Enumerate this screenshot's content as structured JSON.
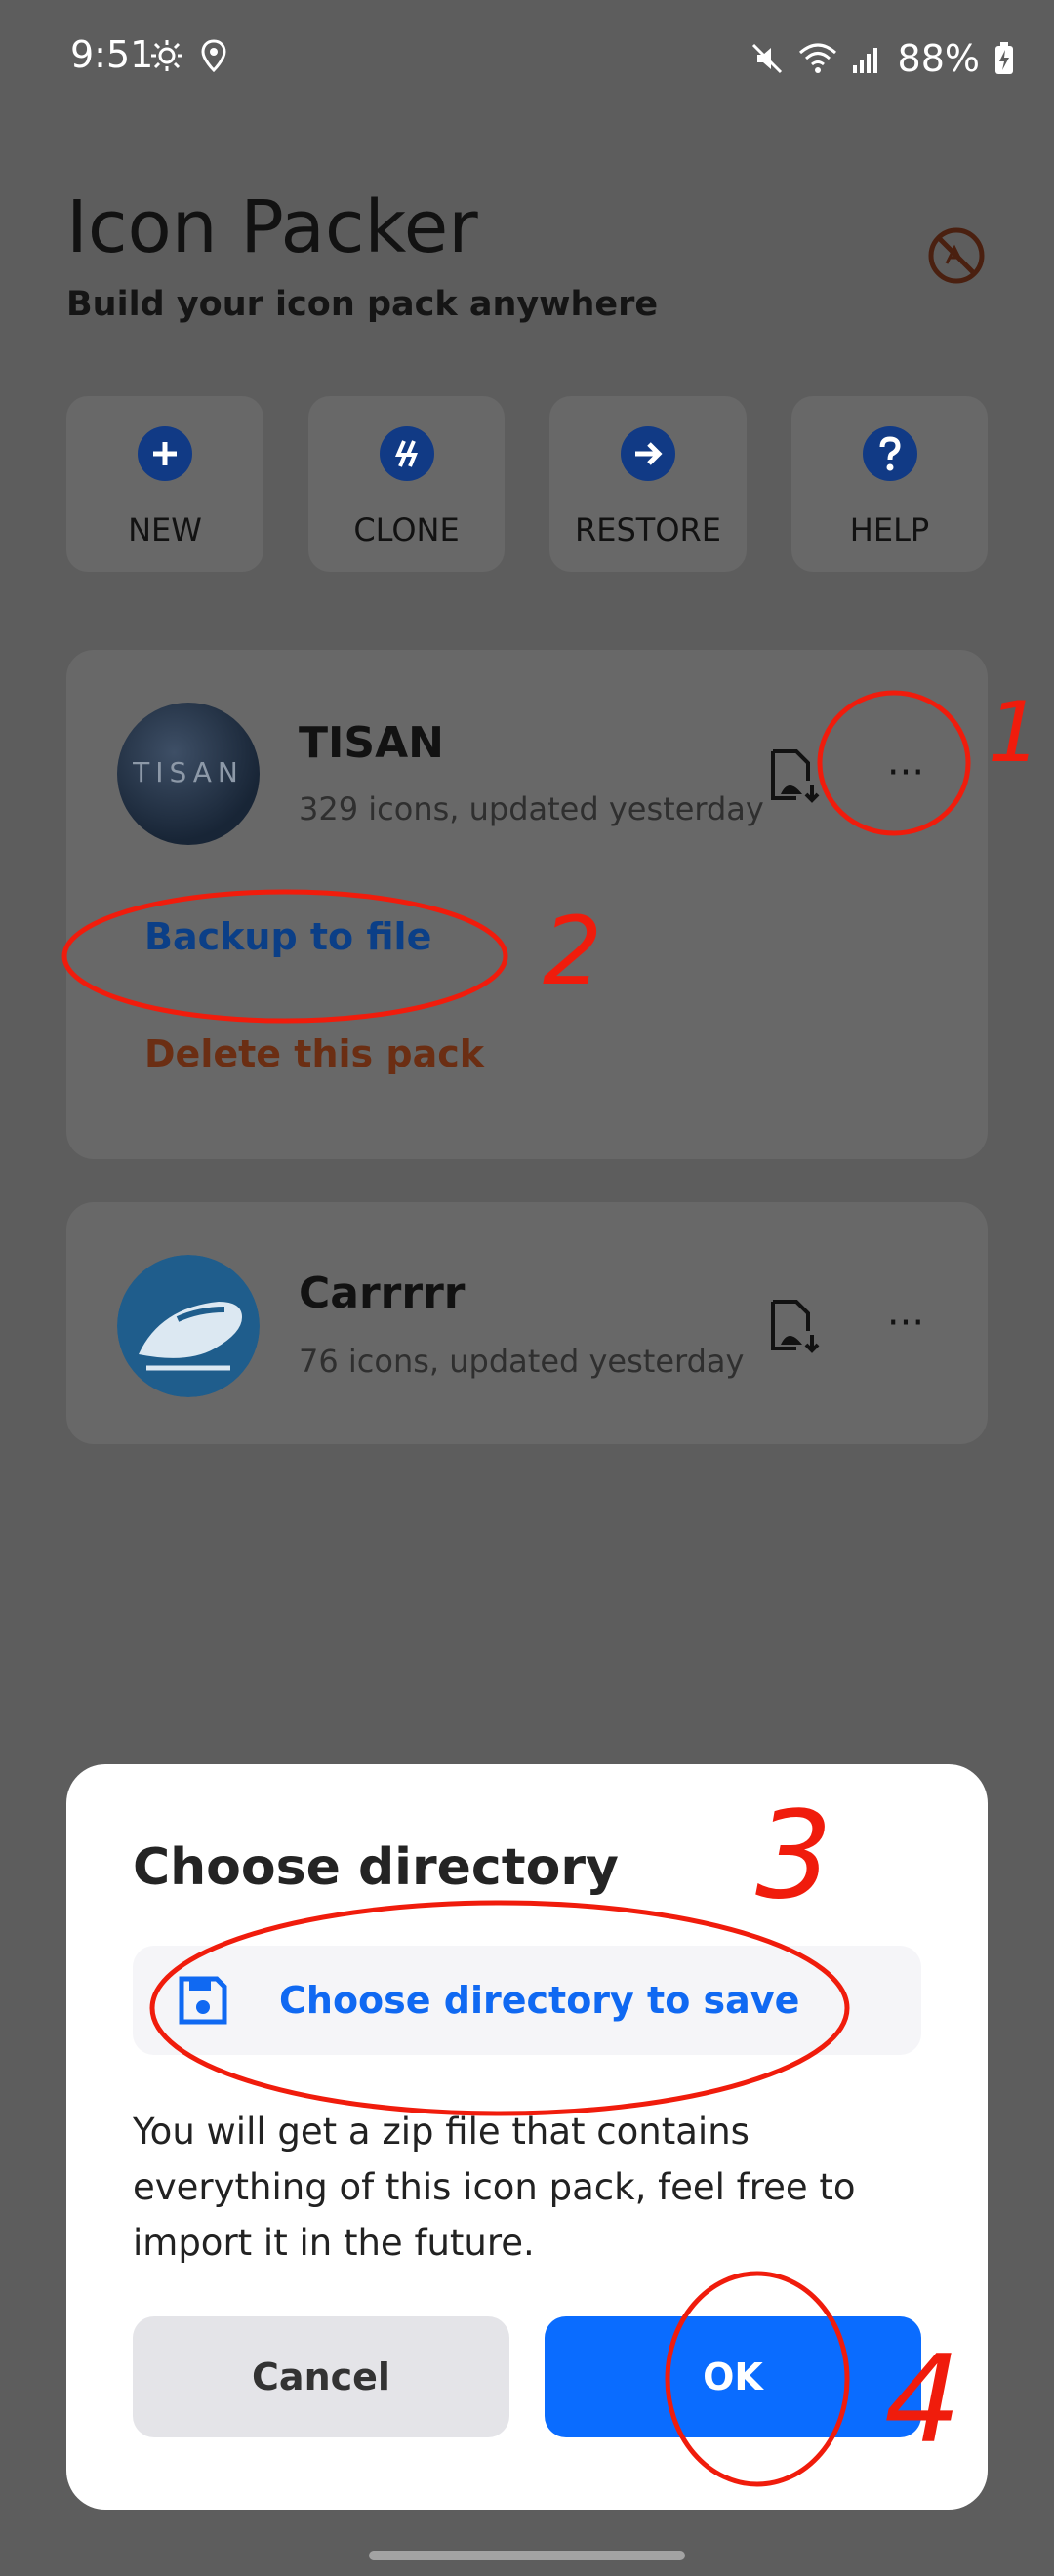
{
  "status_bar": {
    "time": "9:51",
    "battery": "88%"
  },
  "header": {
    "title": "Icon Packer",
    "subtitle": "Build your icon pack anywhere",
    "ads_icon": "no-ads-icon"
  },
  "actions": [
    {
      "label": "NEW",
      "icon": "plus-circle-icon"
    },
    {
      "label": "CLONE",
      "icon": "clone-icon"
    },
    {
      "label": "RESTORE",
      "icon": "arrow-right-circle-icon"
    },
    {
      "label": "HELP",
      "icon": "help-circle-icon"
    }
  ],
  "packs": [
    {
      "name": "TISAN",
      "meta": "329 icons, updated yesterday",
      "avatar_text": "TISAN",
      "menu": {
        "backup": "Backup to file",
        "delete": "Delete this pack"
      }
    },
    {
      "name": "Carrrrr",
      "meta": "76 icons, updated yesterday"
    }
  ],
  "dialog": {
    "title": "Choose directory",
    "choose_label": "Choose directory to save",
    "body": "You will get a zip file that contains everything of this icon pack, feel free to import it in the future.",
    "cancel": "Cancel",
    "ok": "OK"
  },
  "annotations": [
    "1",
    "2",
    "3",
    "4"
  ],
  "colors": {
    "accent": "#0a6cff",
    "overlay": "#5d5d5d",
    "annotation": "#f01c0c"
  }
}
